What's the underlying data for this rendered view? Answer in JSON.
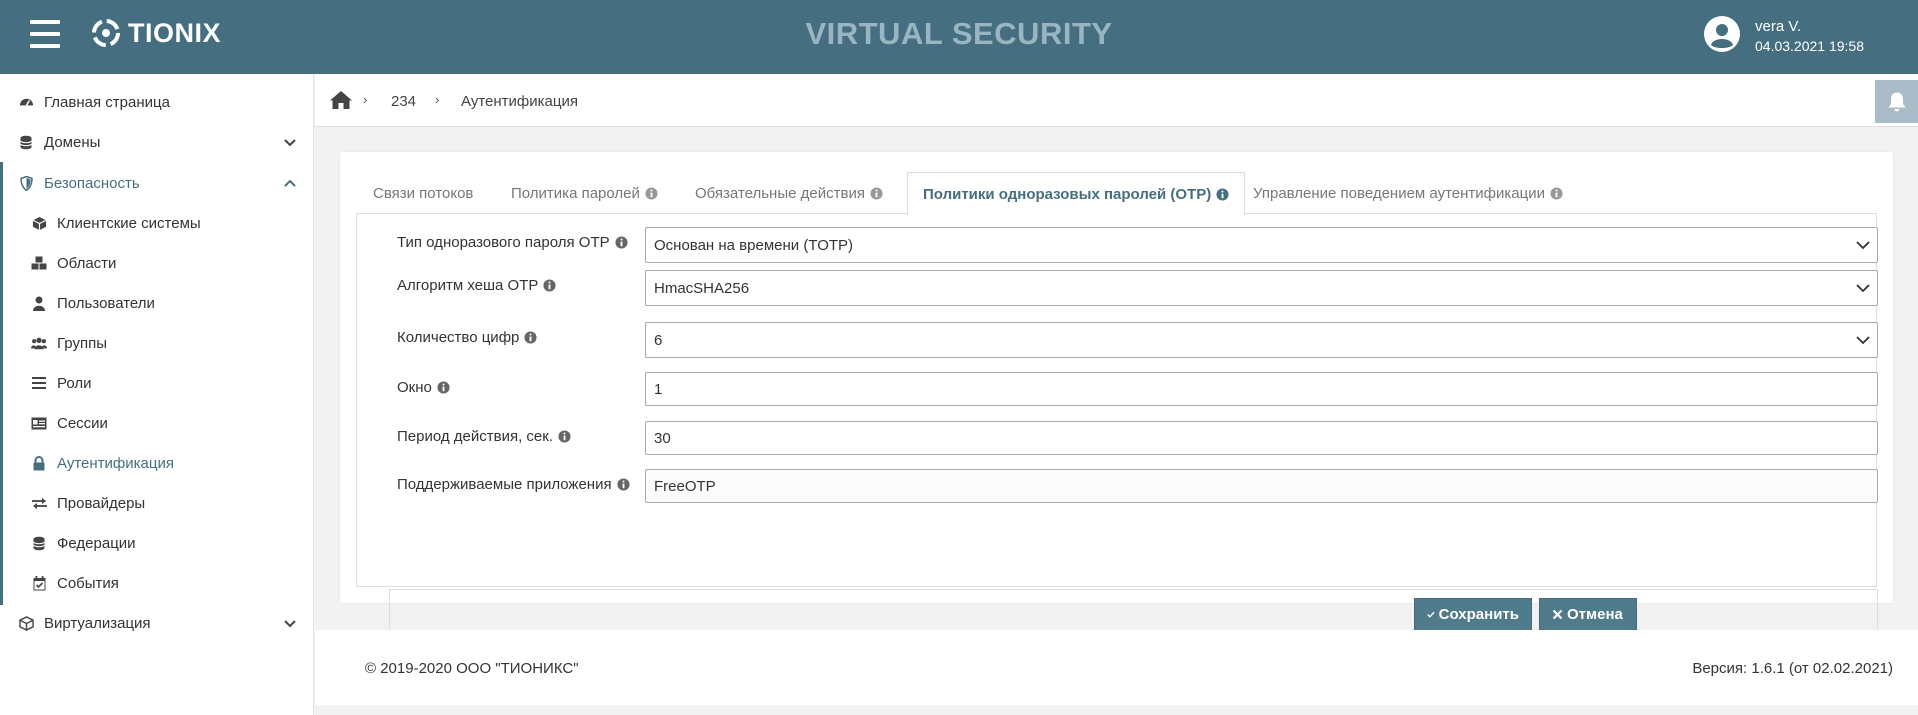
{
  "header": {
    "logo_text": "TIONIX",
    "app_title": "VIRTUAL SECURITY",
    "user_name": "vera V.",
    "user_datetime": "04.03.2021 19:58"
  },
  "sidebar": {
    "items": [
      {
        "label": "Главная страница",
        "icon": "dashboard-icon"
      },
      {
        "label": "Домены",
        "icon": "database-icon",
        "expandable": true,
        "expanded": false
      },
      {
        "label": "Безопасность",
        "icon": "shield-icon",
        "expandable": true,
        "expanded": true
      },
      {
        "label": "Виртуализация",
        "icon": "cube-icon",
        "expandable": true,
        "expanded": false
      }
    ],
    "security_items": [
      {
        "label": "Клиентские системы",
        "icon": "cube-icon"
      },
      {
        "label": "Области",
        "icon": "cubes-icon"
      },
      {
        "label": "Пользователи",
        "icon": "user-icon"
      },
      {
        "label": "Группы",
        "icon": "users-icon"
      },
      {
        "label": "Роли",
        "icon": "list-icon"
      },
      {
        "label": "Сессии",
        "icon": "id-card-icon"
      },
      {
        "label": "Аутентификация",
        "icon": "lock-icon",
        "active": true
      },
      {
        "label": "Провайдеры",
        "icon": "exchange-icon"
      },
      {
        "label": "Федерации",
        "icon": "database-icon"
      },
      {
        "label": "События",
        "icon": "calendar-check-icon"
      }
    ]
  },
  "breadcrumb": {
    "items": [
      "234",
      "Аутентификация"
    ],
    "separator": "›"
  },
  "tabs": [
    {
      "label": "Связи потоков",
      "info": false
    },
    {
      "label": "Политика паролей",
      "info": true
    },
    {
      "label": "Обязательные действия",
      "info": true
    },
    {
      "label": "Политики одноразовых паролей (OTP)",
      "info": true,
      "active": true
    },
    {
      "label": "Управление поведением аутентификации",
      "info": true
    }
  ],
  "form": {
    "otp_type": {
      "label": "Тип одноразового пароля OTP",
      "value": "Основан на времени (TOTP)"
    },
    "hash_algorithm": {
      "label": "Алгоритм хеша OTP",
      "value": "HmacSHA256"
    },
    "digits": {
      "label": "Количество цифр",
      "value": "6"
    },
    "window": {
      "label": "Окно",
      "value": "1"
    },
    "period": {
      "label": "Период действия, сек.",
      "value": "30"
    },
    "apps": {
      "label": "Поддерживаемые приложения",
      "value": "FreeOTP"
    }
  },
  "buttons": {
    "save": "Сохранить",
    "cancel": "Отмена"
  },
  "footer": {
    "copyright": "© 2019-2020 ООО \"ТИОНИКС\"",
    "version": "Версия: 1.6.1 (от 02.02.2021)"
  },
  "colors": {
    "header_bg": "#456f80",
    "accent": "#456f80",
    "button_bg": "#507b8b",
    "bell_bg": "#a9bcc8"
  }
}
